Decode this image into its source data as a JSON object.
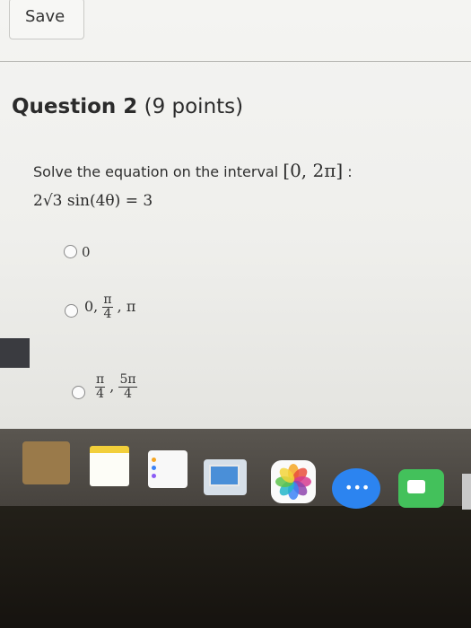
{
  "toolbar": {
    "save_label": "Save"
  },
  "question": {
    "number_label": "Question 2",
    "points_label": "(9 points)",
    "prompt": "Solve the equation on the interval",
    "interval": "[0, 2π]",
    "colon": ":",
    "equation": "2√3 sin(4θ) = 3"
  },
  "options": [
    {
      "text": "0"
    },
    {
      "lead": "0,",
      "frac_num": "π",
      "frac_den": "4",
      "tail": ", π"
    },
    {
      "frac1_num": "π",
      "frac1_den": "4",
      "sep": ",",
      "frac2_num": "5π",
      "frac2_den": "4"
    }
  ],
  "dock": {
    "icons": [
      "launchpad-icon",
      "notes-icon",
      "reminders-icon",
      "keynote-icon",
      "photos-icon",
      "messages-icon",
      "facetime-icon"
    ],
    "messages_dots": "•••"
  },
  "colors": {
    "page_bg": "#f0f0ee",
    "text": "#2b2b2b",
    "dock": "#4f4b46",
    "bezel": "#1a1714"
  }
}
